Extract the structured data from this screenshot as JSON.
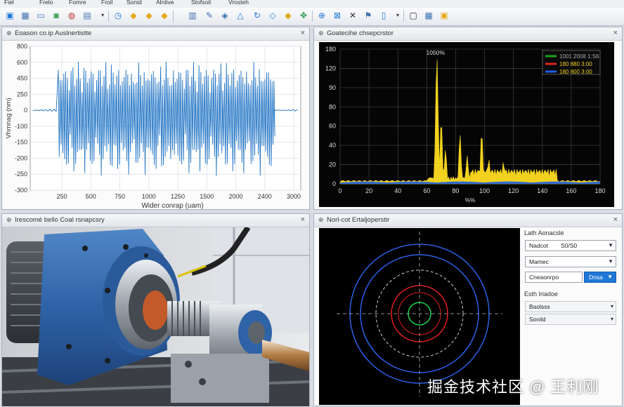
{
  "menu": [
    "Fiel",
    "Frelo",
    "Fomre",
    "Froil",
    "Sonid",
    "Alntive",
    "Stofsoit",
    "Vrosteh"
  ],
  "toolbar": {
    "icons": [
      "save-icon",
      "grid-icon",
      "window-icon",
      "chart-icon",
      "report-icon",
      "dropdown-icon",
      "clock-icon",
      "diamond-icon",
      "diamond-icon",
      "diamond-icon",
      "list-icon",
      "wand-icon",
      "diamond-icon",
      "triangle-icon",
      "refresh-icon",
      "arrow-icon",
      "crosshair-icon",
      "zoom-box-icon",
      "x-icon",
      "flag-icon",
      "dropdown-icon",
      "export-icon",
      "image-icon",
      "window-icon"
    ],
    "colors": {
      "accent": "#1e78d7",
      "gold": "#e6a817"
    }
  },
  "panels": {
    "time": {
      "title": "Eoason co.ip Auslnertistte",
      "close": "×"
    },
    "spectrum": {
      "title": "Goatecihe chsepcrstor",
      "close": "×"
    },
    "photo": {
      "title": "Irescomé bello Coal rsnapcsry",
      "close": "×"
    },
    "orbit": {
      "title": "Norl-cot Ertaljoperstir",
      "close": "×"
    }
  },
  "controls": {
    "section1": "Lath Aonacsle",
    "select1": {
      "value": "Nadcot",
      "value2": "S0/S0"
    },
    "select2": {
      "value": "Mamec"
    },
    "input3": {
      "value": "Cneaonrpo"
    },
    "button": {
      "label": "Dnsa"
    },
    "section2": "Esth Iriadoe",
    "select4": {
      "value": "Baolsss"
    },
    "select5": {
      "value": "Sonild"
    }
  },
  "watermark": "掘金技术社区 @ 王利刚",
  "chart_data": [
    {
      "type": "line",
      "title": "Eoason co.ip Auslnertistte",
      "xlabel": "Wider conrap (uam)",
      "ylabel": "Vhrnnag (nm)",
      "ylim": [
        -300,
        800
      ],
      "yticks": [
        800,
        600,
        450,
        250,
        0,
        -100,
        -150,
        -200,
        -250,
        -300
      ],
      "xticks": [
        "250",
        "500",
        "750",
        "1000",
        "1250",
        "1500",
        "2000",
        "2400",
        "3000"
      ],
      "grid": true,
      "description_values": {
        "baseline": 0,
        "burst_start_x": 200,
        "burst_end_x": 2750,
        "peak_positive": 640,
        "peak_negative": -270
      }
    },
    {
      "type": "area",
      "title": "Goatecihe chsepcrstor",
      "annotation": "1050%",
      "yticks": [
        180,
        120,
        90,
        80,
        60,
        40,
        20,
        0
      ],
      "xticks": [
        0,
        20,
        40,
        60,
        80,
        100,
        120,
        140,
        160,
        180
      ],
      "xlabel": "%%",
      "grid": true,
      "legend_position": "top-right",
      "series": [
        {
          "name": "1001 2008 1:S6",
          "color": "#1aa31a"
        },
        {
          "name": "180 880 3:00",
          "color": "#e02020"
        },
        {
          "name": "180 800 3:00",
          "color": "#1f5fe6"
        }
      ],
      "main_color": "#f2d21e",
      "peaks": [
        {
          "x": 67,
          "y": 190
        },
        {
          "x": 70,
          "y": 98
        },
        {
          "x": 73,
          "y": 52
        },
        {
          "x": 83,
          "y": 75
        },
        {
          "x": 88,
          "y": 42
        },
        {
          "x": 98,
          "y": 79
        },
        {
          "x": 103,
          "y": 37
        },
        {
          "x": 113,
          "y": 33
        },
        {
          "x": 130,
          "y": 16
        }
      ]
    }
  ]
}
